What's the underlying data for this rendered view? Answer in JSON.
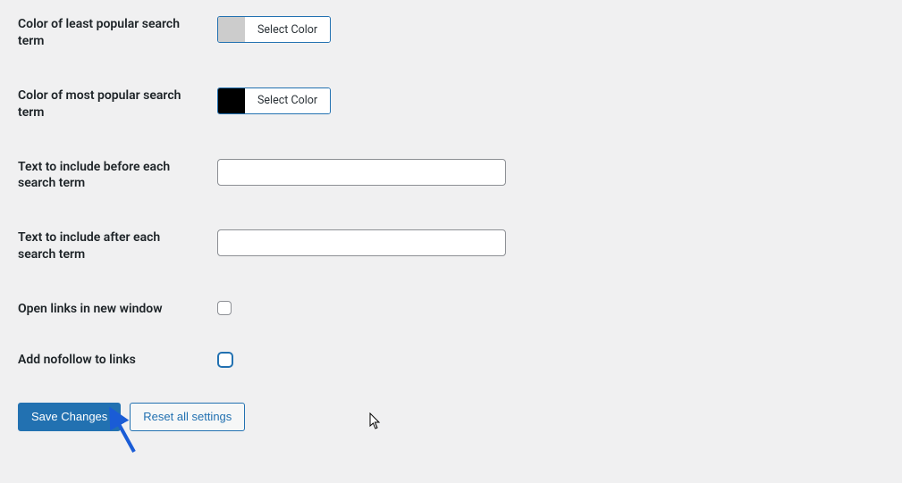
{
  "fields": {
    "least_popular_color": {
      "label": "Color of least popular search term",
      "button_label": "Select Color",
      "swatch_color": "#cccccc"
    },
    "most_popular_color": {
      "label": "Color of most popular search term",
      "button_label": "Select Color",
      "swatch_color": "#000000"
    },
    "text_before": {
      "label": "Text to include before each search term",
      "value": ""
    },
    "text_after": {
      "label": "Text to include after each search term",
      "value": ""
    },
    "open_new_window": {
      "label": "Open links in new window",
      "checked": false
    },
    "add_nofollow": {
      "label": "Add nofollow to links",
      "checked": false
    }
  },
  "buttons": {
    "save": "Save Changes",
    "reset": "Reset all settings"
  },
  "annotations": {
    "arrow_color": "#1a5cd6"
  }
}
